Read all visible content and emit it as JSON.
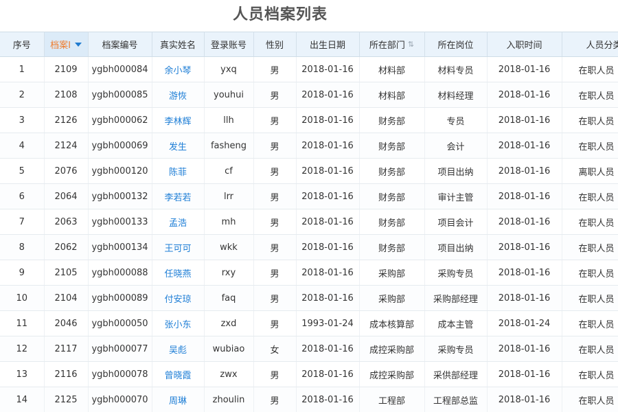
{
  "page": {
    "title": "人员档案列表"
  },
  "table": {
    "columns": [
      {
        "key": "seq",
        "label": "序号"
      },
      {
        "key": "file_id",
        "label": "档案I"
      },
      {
        "key": "file_no",
        "label": "档案编号"
      },
      {
        "key": "name",
        "label": "真实姓名"
      },
      {
        "key": "account",
        "label": "登录账号"
      },
      {
        "key": "gender",
        "label": "性别"
      },
      {
        "key": "birth",
        "label": "出生日期"
      },
      {
        "key": "dept",
        "label": "所在部门"
      },
      {
        "key": "post",
        "label": "所在岗位"
      },
      {
        "key": "hire",
        "label": "入职时间"
      },
      {
        "key": "category",
        "label": "人员分类"
      }
    ],
    "sorted_column": "file_id",
    "sort_icon": "sort-descending-icon",
    "dept_sort_icon": "sort-toggle-icon",
    "rows": [
      [
        "1",
        "2109",
        "ygbh000084",
        "余小琴",
        "yxq",
        "男",
        "2018-01-16",
        "材料部",
        "材料专员",
        "2018-01-16",
        "在职人员"
      ],
      [
        "2",
        "2108",
        "ygbh000085",
        "游恢",
        "youhui",
        "男",
        "2018-01-16",
        "材料部",
        "材料经理",
        "2018-01-16",
        "在职人员"
      ],
      [
        "3",
        "2126",
        "ygbh000062",
        "李林辉",
        "llh",
        "男",
        "2018-01-16",
        "财务部",
        "专员",
        "2018-01-16",
        "在职人员"
      ],
      [
        "4",
        "2124",
        "ygbh000069",
        "发生",
        "fasheng",
        "男",
        "2018-01-16",
        "财务部",
        "会计",
        "2018-01-16",
        "在职人员"
      ],
      [
        "5",
        "2076",
        "ygbh000120",
        "陈菲",
        "cf",
        "男",
        "2018-01-16",
        "财务部",
        "项目出纳",
        "2018-01-16",
        "离职人员"
      ],
      [
        "6",
        "2064",
        "ygbh000132",
        "李若若",
        "lrr",
        "男",
        "2018-01-16",
        "财务部",
        "审计主管",
        "2018-01-16",
        "在职人员"
      ],
      [
        "7",
        "2063",
        "ygbh000133",
        "孟浩",
        "mh",
        "男",
        "2018-01-16",
        "财务部",
        "项目会计",
        "2018-01-16",
        "在职人员"
      ],
      [
        "8",
        "2062",
        "ygbh000134",
        "王可可",
        "wkk",
        "男",
        "2018-01-16",
        "财务部",
        "项目出纳",
        "2018-01-16",
        "在职人员"
      ],
      [
        "9",
        "2105",
        "ygbh000088",
        "任晓燕",
        "rxy",
        "男",
        "2018-01-16",
        "采购部",
        "采购专员",
        "2018-01-16",
        "在职人员"
      ],
      [
        "10",
        "2104",
        "ygbh000089",
        "付安琼",
        "faq",
        "男",
        "2018-01-16",
        "采购部",
        "采购部经理",
        "2018-01-16",
        "在职人员"
      ],
      [
        "11",
        "2046",
        "ygbh000050",
        "张小东",
        "zxd",
        "男",
        "1993-01-24",
        "成本核算部",
        "成本主管",
        "2018-01-24",
        "在职人员"
      ],
      [
        "12",
        "2117",
        "ygbh000077",
        "吴彪",
        "wubiao",
        "女",
        "2018-01-16",
        "成控采购部",
        "采购专员",
        "2018-01-16",
        "在职人员"
      ],
      [
        "13",
        "2116",
        "ygbh000078",
        "曾晓霞",
        "zwx",
        "男",
        "2018-01-16",
        "成控采购部",
        "采供部经理",
        "2018-01-16",
        "在职人员"
      ],
      [
        "14",
        "2125",
        "ygbh000070",
        "周琳",
        "zhoulin",
        "男",
        "2018-01-16",
        "工程部",
        "工程部总监",
        "2018-01-16",
        "在职人员"
      ]
    ]
  }
}
